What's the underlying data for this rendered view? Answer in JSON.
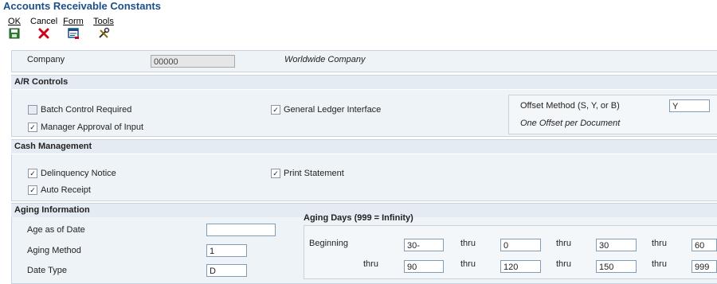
{
  "title": "Accounts Receivable Constants",
  "toolbar": {
    "ok_label": "OK",
    "cancel_label": "Cancel",
    "form_label": "Form",
    "tools_label": "Tools"
  },
  "company": {
    "label": "Company",
    "value": "00000",
    "name": "Worldwide Company"
  },
  "ar_controls": {
    "heading": "A/R Controls",
    "batch_control": {
      "label": "Batch Control Required",
      "checked": false
    },
    "manager_approval": {
      "label": "Manager Approval of Input",
      "checked": true
    },
    "gl_interface": {
      "label": "General Ledger Interface",
      "checked": true
    },
    "offset_method_label": "Offset Method (S, Y, or B)",
    "offset_method_value": "Y",
    "offset_description": "One Offset per Document"
  },
  "cash_management": {
    "heading": "Cash Management",
    "delinquency_notice": {
      "label": "Delinquency Notice",
      "checked": true
    },
    "auto_receipt": {
      "label": "Auto Receipt",
      "checked": true
    },
    "print_statement": {
      "label": "Print Statement",
      "checked": true
    }
  },
  "aging": {
    "heading": "Aging Information",
    "age_as_of_date_label": "Age as of Date",
    "age_as_of_date_value": "",
    "aging_method_label": "Aging Method",
    "aging_method_value": "1",
    "date_type_label": "Date Type",
    "date_type_value": "D",
    "days_heading": "Aging Days (999 = Infinity)",
    "beginning_label": "Beginning",
    "thru_label": "thru",
    "row1": [
      "30-",
      "0",
      "30",
      "60"
    ],
    "row2": [
      "90",
      "120",
      "150",
      "999"
    ]
  },
  "colors": {
    "title": "#1b4f8a",
    "panel": "#eef3f8",
    "section_header": "#e4ebf2",
    "cancel_red": "#d0021b",
    "save_green": "#2e7d32"
  },
  "icons": [
    "save-icon",
    "cancel-x-icon",
    "form-icon",
    "tools-icon"
  ]
}
